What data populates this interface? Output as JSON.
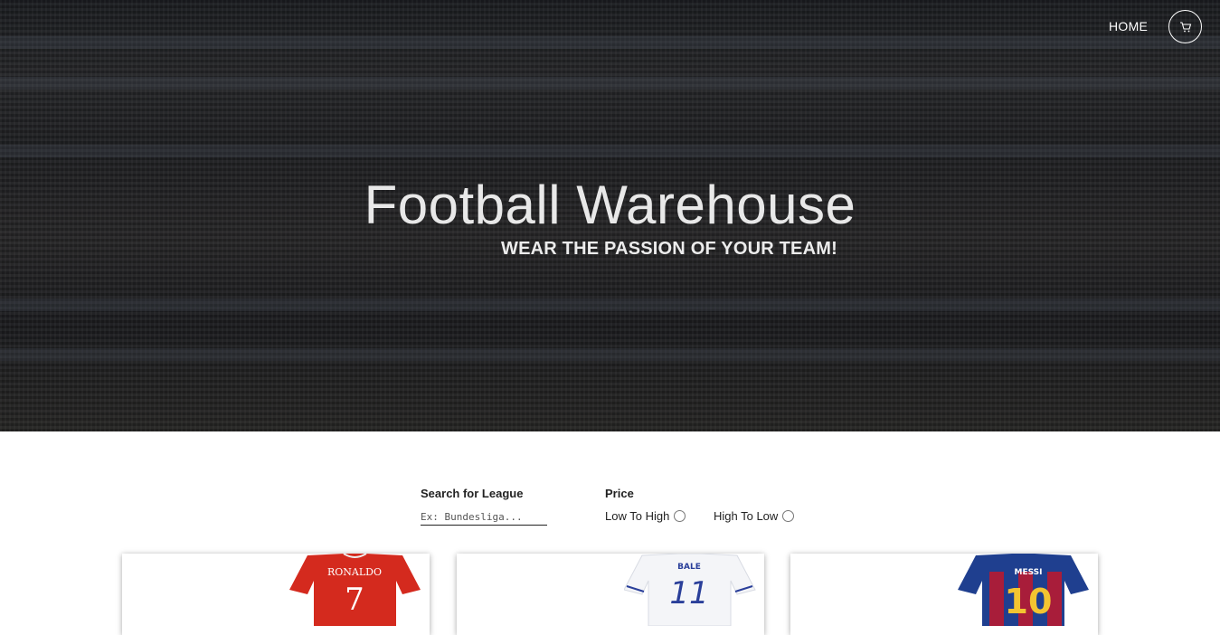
{
  "hero": {
    "title": "Football Warehouse",
    "subtitle": "WEAR THE PASSION OF YOUR TEAM!"
  },
  "nav": {
    "home_label": "HOME",
    "cart_icon": "cart-icon"
  },
  "filters": {
    "search": {
      "label": "Search for League",
      "placeholder": "Ex: Bundesliga..."
    },
    "price": {
      "label": "Price",
      "options": [
        "Low To High",
        "High To Low"
      ]
    }
  },
  "products": [
    {
      "player": "RONALDO",
      "number": "7",
      "colors": {
        "shirt": "#d42a1e",
        "text": "#ffffff"
      }
    },
    {
      "player": "BALE",
      "number": "11",
      "colors": {
        "shirt": "#f4f5f8",
        "text": "#2a3f9a"
      }
    },
    {
      "player": "MESSI",
      "number": "10",
      "colors": {
        "shirt": "#1f3f8f",
        "text": "#f3c431",
        "stripe": "#a81d3a"
      }
    }
  ]
}
